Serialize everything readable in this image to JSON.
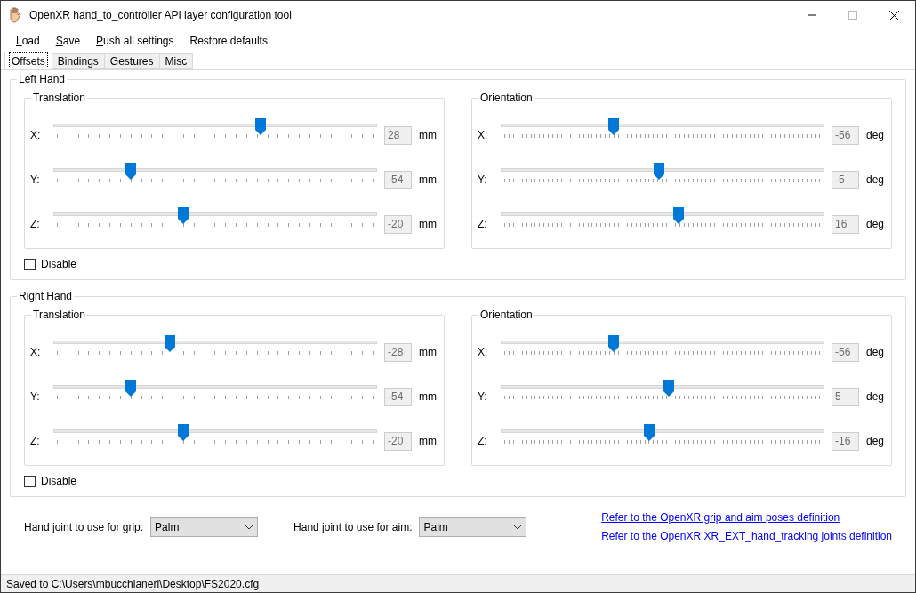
{
  "window": {
    "title": "OpenXR hand_to_controller API layer configuration tool"
  },
  "menu": [
    {
      "label": "Load",
      "mnemonic": true
    },
    {
      "label": "Save",
      "mnemonic": true
    },
    {
      "label": "Push all settings",
      "mnemonic": true
    },
    {
      "label": "Restore defaults",
      "mnemonic": false
    }
  ],
  "tabs": [
    {
      "label": "Offsets",
      "selected": true
    },
    {
      "label": "Bindings",
      "selected": false
    },
    {
      "label": "Gestures",
      "selected": false
    },
    {
      "label": "Misc",
      "selected": false
    }
  ],
  "hands": [
    {
      "title": "Left Hand",
      "groups": [
        {
          "title": "Translation",
          "kind": "translation",
          "axes": [
            {
              "label": "X:",
              "level": 0.64,
              "value": "28",
              "unit": "mm"
            },
            {
              "label": "Y:",
              "level": 0.24,
              "value": "-54",
              "unit": "mm"
            },
            {
              "label": "Z:",
              "level": 0.4,
              "value": "-20",
              "unit": "mm"
            }
          ]
        },
        {
          "title": "Orientation",
          "kind": "orientation",
          "axes": [
            {
              "label": "X:",
              "level": 0.35,
              "value": "-56",
              "unit": "deg"
            },
            {
              "label": "Y:",
              "level": 0.49,
              "value": "-5",
              "unit": "deg"
            },
            {
              "label": "Z:",
              "level": 0.55,
              "value": "16",
              "unit": "deg"
            }
          ]
        }
      ],
      "disable": {
        "label": "Disable",
        "checked": false
      }
    },
    {
      "title": "Right Hand",
      "groups": [
        {
          "title": "Translation",
          "kind": "translation",
          "axes": [
            {
              "label": "X:",
              "level": 0.36,
              "value": "-28",
              "unit": "mm"
            },
            {
              "label": "Y:",
              "level": 0.24,
              "value": "-54",
              "unit": "mm"
            },
            {
              "label": "Z:",
              "level": 0.4,
              "value": "-20",
              "unit": "mm"
            }
          ]
        },
        {
          "title": "Orientation",
          "kind": "orientation",
          "axes": [
            {
              "label": "X:",
              "level": 0.35,
              "value": "-56",
              "unit": "deg"
            },
            {
              "label": "Y:",
              "level": 0.52,
              "value": "5",
              "unit": "deg"
            },
            {
              "label": "Z:",
              "level": 0.46,
              "value": "-16",
              "unit": "deg"
            }
          ]
        }
      ],
      "disable": {
        "label": "Disable",
        "checked": false
      }
    }
  ],
  "grip": {
    "label": "Hand joint to use for grip:",
    "value": "Palm"
  },
  "aim": {
    "label": "Hand joint to use for aim:",
    "value": "Palm"
  },
  "links": [
    "Refer to the OpenXR grip and aim poses definition",
    "Refer to the OpenXR XR_EXT_hand_tracking joints definition"
  ],
  "status_bar": "Saved to C:\\Users\\mbucchianeri\\Desktop\\FS2020.cfg"
}
